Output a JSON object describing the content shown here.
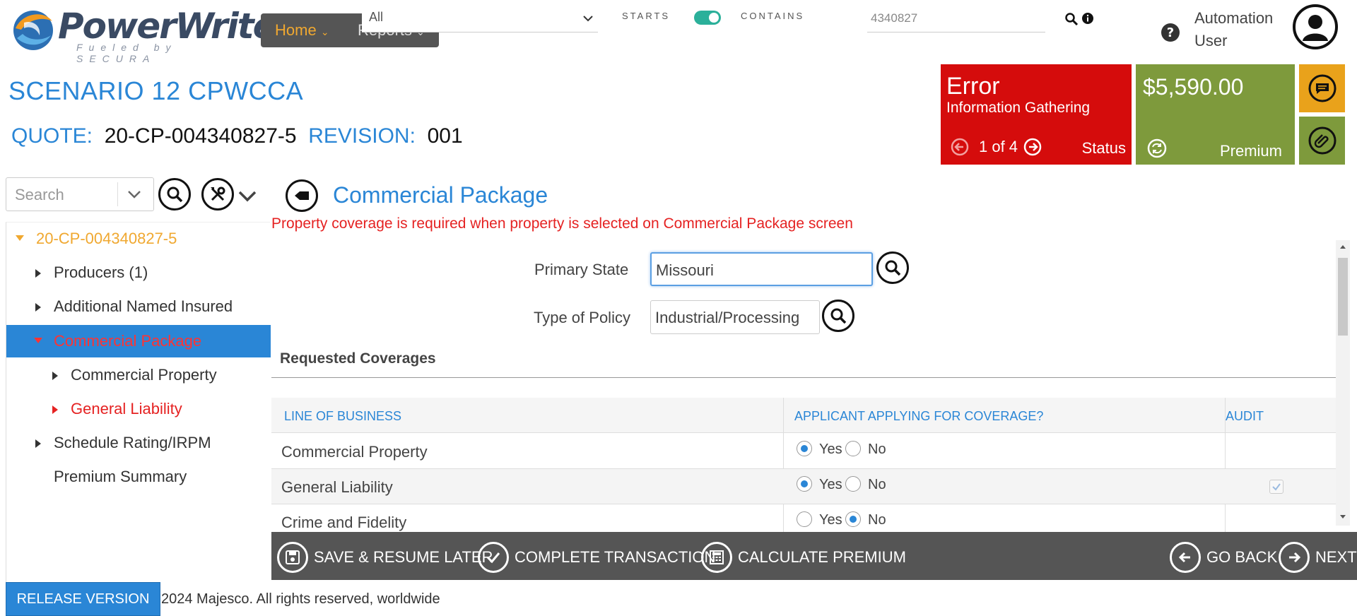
{
  "header": {
    "logo_text": "PowerWriter",
    "logo_tagline": "Fueled by SECURA",
    "nav": {
      "home_label": "Home",
      "reports_label": "Reports"
    },
    "filter": {
      "selected": "All"
    },
    "search_mode": {
      "starts_label": "STARTS",
      "contains_label": "CONTAINS",
      "toggle_on": true
    },
    "search": {
      "value": "4340827"
    },
    "user": {
      "name_line1": "Automation",
      "name_line2": "User"
    }
  },
  "title": {
    "scenario": "SCENARIO 12 CPWCCA",
    "quote_label": "QUOTE:",
    "quote_value": "20-CP-004340827-5",
    "revision_label": "REVISION:",
    "revision_value": "001"
  },
  "status_tiles": {
    "error": {
      "title": "Error",
      "subtitle": "Information Gathering",
      "pager": "1 of 4",
      "label": "Status"
    },
    "premium": {
      "amount": "$5,590.00",
      "label": "Premium"
    },
    "colors": {
      "error": "#d50c0c",
      "premium": "#7e9a3c",
      "notes": "#e9a21b"
    }
  },
  "sidebar": {
    "search_placeholder": "Search",
    "tree": [
      {
        "label": "20-CP-004340827-5",
        "level": 0,
        "expanded": true
      },
      {
        "label": "Producers (1)",
        "level": 1
      },
      {
        "label": "Additional Named Insured",
        "level": 1
      },
      {
        "label": "Commercial Package",
        "level": 1,
        "expanded": true,
        "selected": true
      },
      {
        "label": "Commercial Property",
        "level": 2
      },
      {
        "label": "General Liability",
        "level": 2,
        "error": true
      },
      {
        "label": "Schedule Rating/IRPM",
        "level": 1
      },
      {
        "label": "Premium Summary",
        "level": 1
      }
    ]
  },
  "main": {
    "section_title": "Commercial Package",
    "error_message": "Property coverage is required when property is selected on Commercial Package screen",
    "primary_state": {
      "label": "Primary State",
      "value": "Missouri"
    },
    "policy_type": {
      "label": "Type of Policy",
      "value": "Industrial/Processing"
    },
    "requested_coverages": {
      "title": "Requested Coverages",
      "headers": [
        "LINE OF BUSINESS",
        "APPLICANT APPLYING FOR COVERAGE?",
        "AUDIT"
      ],
      "yes_label": "Yes",
      "no_label": "No",
      "rows": [
        {
          "line": "Commercial Property",
          "applying": "Yes",
          "audit": null
        },
        {
          "line": "General Liability",
          "applying": "Yes",
          "audit": true
        },
        {
          "line": "Crime and Fidelity",
          "applying": "No",
          "audit": null
        }
      ]
    }
  },
  "actions": {
    "save": "SAVE & RESUME LATER",
    "complete": "COMPLETE TRANSACTION",
    "calculate": "CALCULATE PREMIUM",
    "back": "GO BACK",
    "next": "NEXT"
  },
  "footer": {
    "release_button": "RELEASE VERSION",
    "copyright": "2024 Majesco. All rights reserved, worldwide"
  }
}
